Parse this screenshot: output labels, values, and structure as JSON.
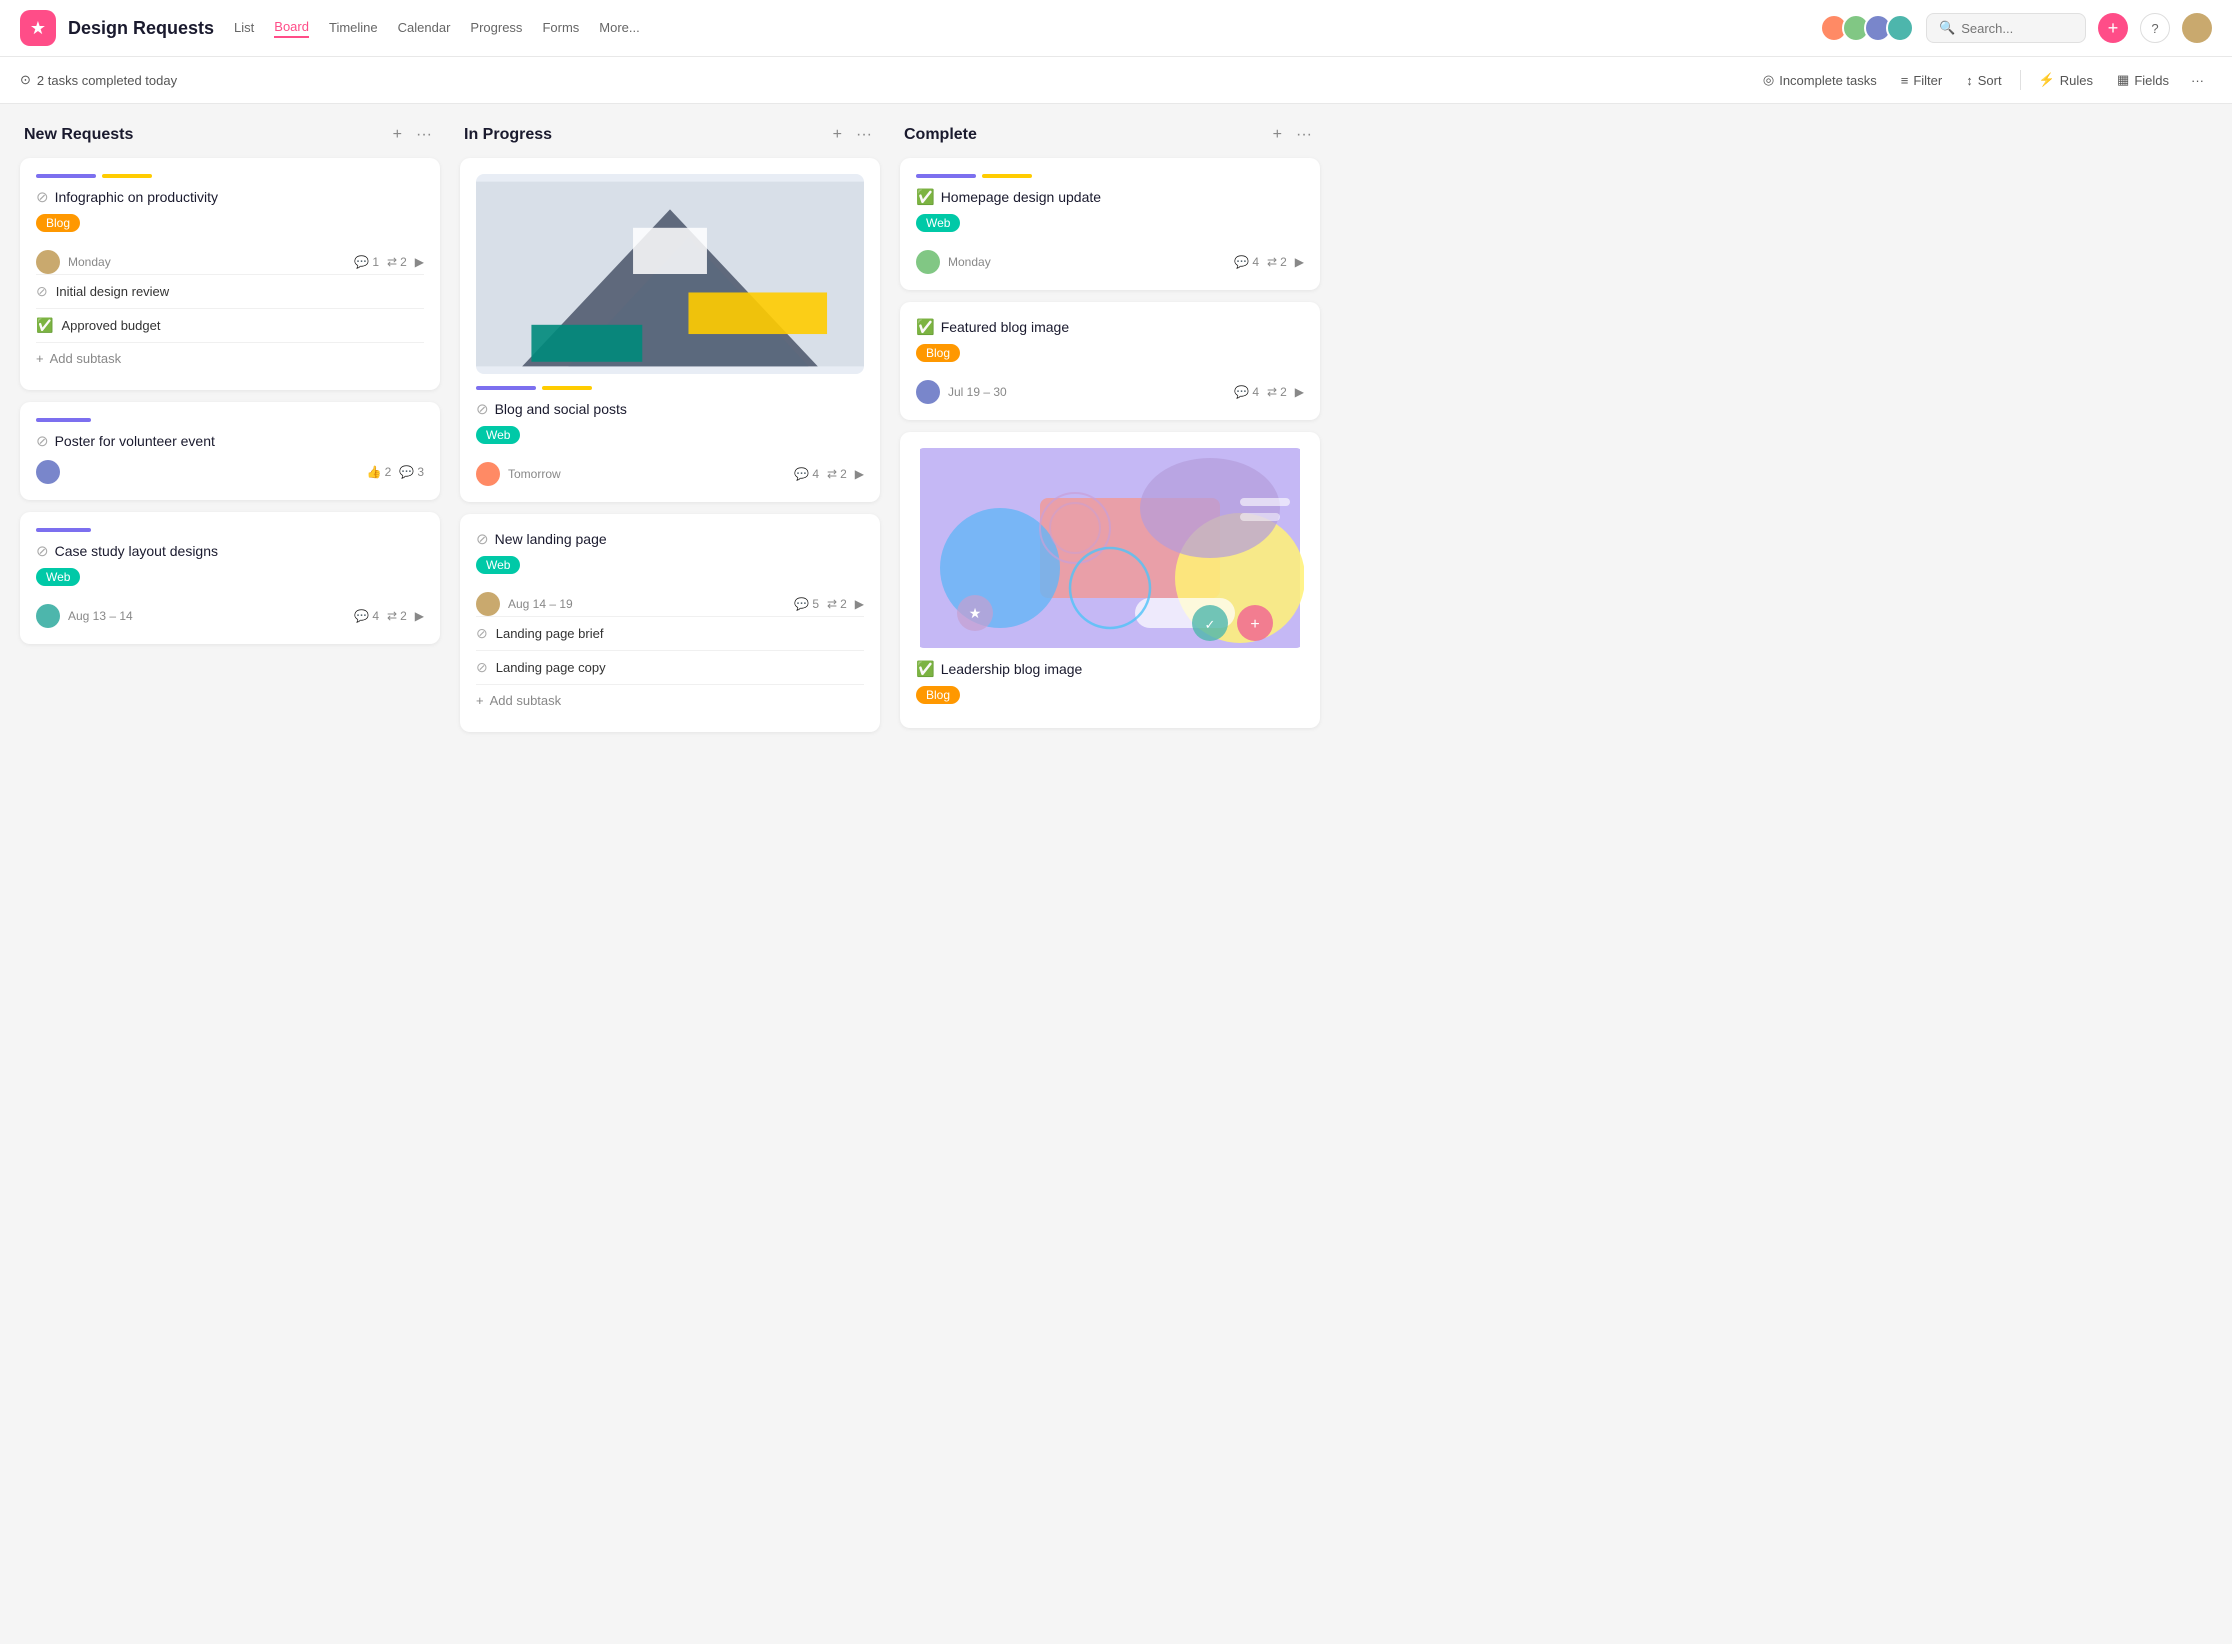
{
  "app": {
    "logo": "★",
    "title": "Design Requests",
    "nav": [
      {
        "label": "List",
        "active": false
      },
      {
        "label": "Board",
        "active": true
      },
      {
        "label": "Timeline",
        "active": false
      },
      {
        "label": "Calendar",
        "active": false
      },
      {
        "label": "Progress",
        "active": false
      },
      {
        "label": "Forms",
        "active": false
      },
      {
        "label": "More...",
        "active": false
      }
    ]
  },
  "toolbar": {
    "status_text": "2 tasks completed today",
    "incomplete_tasks": "Incomplete tasks",
    "filter": "Filter",
    "sort": "Sort",
    "rules": "Rules",
    "fields": "Fields"
  },
  "columns": [
    {
      "title": "New Requests",
      "cards": [
        {
          "id": "c1",
          "color_bars": [
            "#7c6fef",
            "#ffcc00"
          ],
          "icon": "outline",
          "title": "Infographic on productivity",
          "tag": {
            "label": "Blog",
            "type": "orange"
          },
          "avatar": "av-1",
          "date": "Monday",
          "comments": "1",
          "branches": "2",
          "has_arrow": true,
          "subtasks": [
            {
              "icon": "outline",
              "text": "Initial design review",
              "checked": false
            },
            {
              "icon": "checked",
              "text": "Approved budget",
              "checked": true
            }
          ],
          "add_subtask": "Add subtask"
        },
        {
          "id": "c2",
          "color_bars": [
            "#7c6fef"
          ],
          "icon": "outline",
          "title": "Poster for volunteer event",
          "tag": null,
          "avatar": "av-2",
          "date": "",
          "likes": "2",
          "comments": "3",
          "has_arrow": false
        },
        {
          "id": "c3",
          "color_bars": [
            "#7c6fef"
          ],
          "icon": "outline",
          "title": "Case study layout designs",
          "tag": {
            "label": "Web",
            "type": "teal"
          },
          "avatar": "av-3",
          "date": "Aug 13 – 14",
          "comments": "4",
          "branches": "2",
          "has_arrow": true
        }
      ]
    },
    {
      "title": "In Progress",
      "cards": [
        {
          "id": "p1",
          "has_image": true,
          "color_bars": [
            "#7c6fef",
            "#ffcc00"
          ],
          "icon": "outline",
          "title": "Blog and social posts",
          "tag": {
            "label": "Web",
            "type": "teal"
          },
          "avatar": "av-4",
          "date": "Tomorrow",
          "comments": "4",
          "branches": "2",
          "has_arrow": true
        },
        {
          "id": "p2",
          "icon": "outline",
          "title": "New landing page",
          "tag": {
            "label": "Web",
            "type": "teal"
          },
          "avatar": "av-1",
          "date": "Aug 14 – 19",
          "comments": "5",
          "branches": "2",
          "has_arrow": true,
          "subtasks": [
            {
              "icon": "outline",
              "text": "Landing page brief",
              "checked": false
            },
            {
              "icon": "outline",
              "text": "Landing page copy",
              "checked": false
            }
          ],
          "add_subtask": "Add subtask"
        }
      ]
    },
    {
      "title": "Complete",
      "cards": [
        {
          "id": "d1",
          "color_bars": [
            "#7c6fef",
            "#ffcc00"
          ],
          "icon": "checked",
          "title": "Homepage design update",
          "tag": {
            "label": "Web",
            "type": "teal"
          },
          "avatar": "av-5",
          "date": "Monday",
          "comments": "4",
          "branches": "2",
          "has_arrow": true
        },
        {
          "id": "d2",
          "icon": "checked",
          "title": "Featured blog image",
          "tag": {
            "label": "Blog",
            "type": "orange"
          },
          "avatar": "av-2",
          "date": "Jul 19 – 30",
          "comments": "4",
          "branches": "2",
          "has_arrow": true
        },
        {
          "id": "d3",
          "has_design_image": true,
          "icon": "checked",
          "title": "Leadership blog image",
          "tag": {
            "label": "Blog",
            "type": "orange"
          }
        }
      ]
    }
  ]
}
